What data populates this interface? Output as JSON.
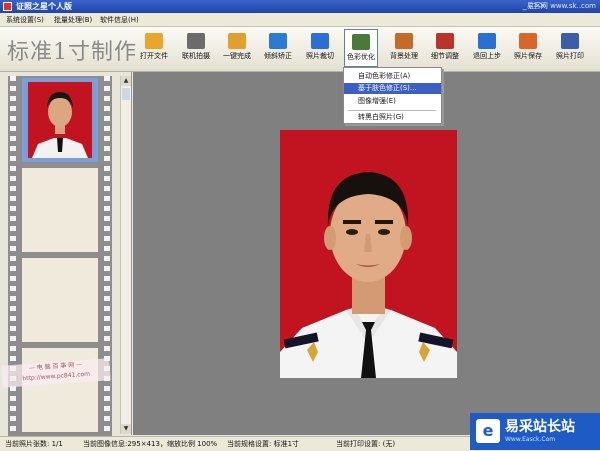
{
  "window": {
    "title": "证照之星个人版",
    "site_tag": "易客网 www.sk..com",
    "controls": "_ □ ×"
  },
  "menu": [
    {
      "label": "系统设置(S)"
    },
    {
      "label": "批量处理(B)"
    },
    {
      "label": "软件信息(H)"
    }
  ],
  "toolbar": {
    "brand": "标准1寸制作",
    "buttons": [
      {
        "label": "打开文件",
        "icon": "folder-icon",
        "color": "#e8a72c"
      },
      {
        "label": "联机拍摄",
        "icon": "camera-icon",
        "color": "#6b6b6b"
      },
      {
        "label": "一键完成",
        "icon": "hand-icon",
        "color": "#e0a030"
      },
      {
        "label": "倾斜矫正",
        "icon": "rotate-icon",
        "color": "#2a7bd1"
      },
      {
        "label": "照片裁切",
        "icon": "crop-icon",
        "color": "#2a6fd1"
      },
      {
        "label": "色彩优化",
        "icon": "palette-icon",
        "color": "#4a7a3a"
      },
      {
        "label": "背景处理",
        "icon": "brush-icon",
        "color": "#c66a2a"
      },
      {
        "label": "细节调整",
        "icon": "chart-icon",
        "color": "#b9342a"
      },
      {
        "label": "退回上步",
        "icon": "undo-icon",
        "color": "#2a6fd1"
      },
      {
        "label": "照片保存",
        "icon": "save-icon",
        "color": "#d9652a"
      },
      {
        "label": "照片打印",
        "icon": "printer-icon",
        "color": "#3a5fa8"
      }
    ]
  },
  "color_menu": {
    "items": [
      {
        "label": "自动色彩修正(A)"
      },
      {
        "label": "基于肤色修正(S)..."
      },
      {
        "label": "图像增强(E)"
      },
      {
        "label": "转黑白照片(G)"
      }
    ]
  },
  "watermark": {
    "line1": "— 电 脑 百 事 网 —",
    "line2": "http://www.pc841.com"
  },
  "status": {
    "photo_count": "当前照片张数: 1/1",
    "image_info": "当前图像信息:295×413，缩放比例 100%",
    "spec": "当前规格设置: 标准1寸",
    "print": "当前打印设置: (无)"
  },
  "logo": {
    "mark": "e",
    "text": "易采站长站",
    "sub": "Www.Easck.Com"
  },
  "colors": {
    "accent": "#3b5fc2",
    "photo_bg": "#c11420",
    "canvas": "#808080"
  }
}
